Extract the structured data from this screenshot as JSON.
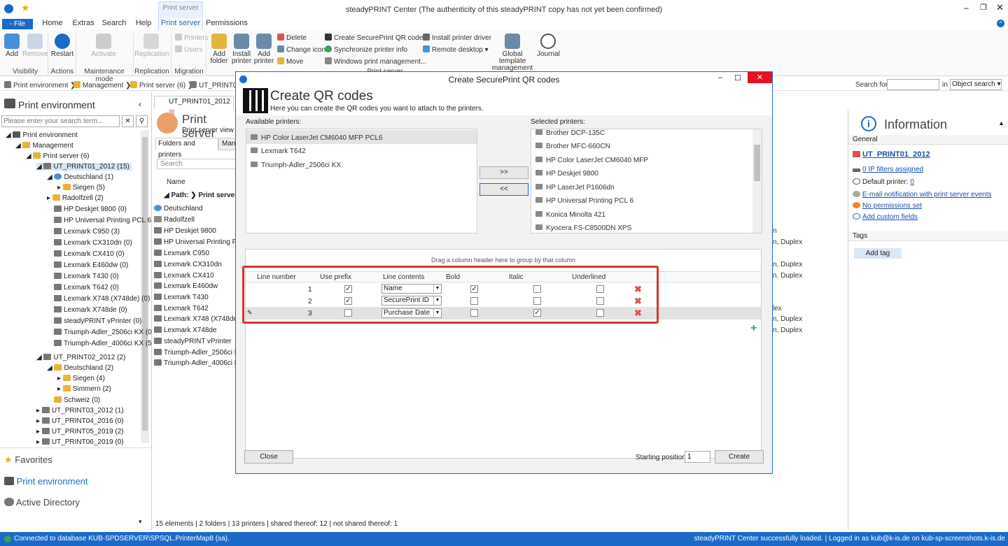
{
  "window": {
    "title": "steadyPRINT Center (The authenticity of this steadyPRINT copy has not yet been confirmed)",
    "context_tab": "Print server"
  },
  "tabs": [
    "- File",
    "Home",
    "Extras",
    "Search",
    "Help",
    "Print server",
    "Permissions"
  ],
  "ribbon": {
    "add": "Add",
    "remove": "Remove",
    "restart": "Restart",
    "activate": "Activate",
    "replication": "Replication",
    "printers": "Printers",
    "users": "Users",
    "add_folder": "Add folder",
    "install_printer": "Install printer",
    "add_printer": "Add printer",
    "delete": "Delete",
    "change_icon": "Change icon",
    "move": "Move",
    "create_qr": "Create SecurePrint QR codes",
    "sync_info": "Synchronize printer info",
    "windows_mgmt": "Windows print management...",
    "install_driver": "Install printer driver",
    "remote_desktop": "Remote desktop",
    "global_template": "Global template management",
    "journal": "Journal",
    "groups": {
      "visibility": "Visibility",
      "actions": "Actions",
      "maintenance": "Maintenance mode",
      "replication": "Replication",
      "migration": "Migration",
      "print_server": "Print server"
    }
  },
  "breadcrumb": {
    "items": [
      "Print environment",
      "Management",
      "Print server (6)",
      "UT_PRINT01_"
    ],
    "search_for": "Search for",
    "in": "in",
    "object_search": "Object search"
  },
  "left": {
    "header": "Print environment",
    "search_placeholder": "Please enter your search term...",
    "tree": [
      "Print environment",
      "Management",
      "Print server (6)",
      "UT_PRINT01_2012 (15)",
      "Deutschland (1)",
      "Siegen (5)",
      "Radolfzell (2)",
      "HP Deskjet 9800 (0)",
      "HP Universal Printing PCL 6",
      "Lexmark C950 (3)",
      "Lexmark CX310dn (0)",
      "Lexmark CX410 (0)",
      "Lexmark E460dw (0)",
      "Lexmark T430 (0)",
      "Lexmark T642 (0)",
      "Lexmark X748 (X748de) (0)",
      "Lexmark X748de (0)",
      "steadyPRINT vPrinter (0)",
      "Triumph-Adler_2506ci KX (0",
      "Triumph-Adler_4006ci KX (5",
      "UT_PRINT02_2012 (2)",
      "Deutschland (2)",
      "Siegen (4)",
      "Simmern (2)",
      "Schweiz (0)",
      "UT_PRINT03_2012 (1)",
      "UT_PRINT04_2016 (0)",
      "UT_PRINT05_2019 (2)",
      "UT_PRINT06_2019 (0)"
    ],
    "nav": [
      "Favorites",
      "Print environment",
      "Active Directory"
    ]
  },
  "middle": {
    "doc_tab": "UT_PRINT01_2012",
    "heading": "Print server",
    "subheading": "Print server view",
    "subtab1": "Folders and printers",
    "subtab2": "Man",
    "search": "Search",
    "col_name": "Name",
    "path": "Path:",
    "path_val": "Print server",
    "rows": [
      "Deutschland",
      "Radolfzell",
      "HP Deskjet 9800",
      "HP Universal Printing PC",
      "Lexmark C950",
      "Lexmark CX310dn",
      "Lexmark CX410",
      "Lexmark E460dw",
      "Lexmark T430",
      "Lexmark T642",
      "Lexmark X748 (X748de)",
      "Lexmark X748de",
      "steadyPRINT vPrinter",
      "Triumph-Adler_2506ci K",
      "Triumph-Adler_4006ci K"
    ],
    "status": "15 elements | 2 folders | 13 printers | shared thereof: 12 | not shared thereof: 1",
    "bleed": [
      "n",
      "n, Duplex",
      "n, Duplex",
      "n, Duplex",
      "lex",
      "n, Duplex",
      "n, Duplex"
    ]
  },
  "info": {
    "title": "Information",
    "general": "General",
    "server": "UT_PRINT01_2012",
    "ip": "0 IP filters assigned",
    "default_label": "Default printer:",
    "default_val": "0",
    "email": "E-mail notification with print server events",
    "perm": "No permissions set",
    "custom": "Add custom fields",
    "tags": "Tags",
    "add_tag": "Add tag"
  },
  "dialog": {
    "title": "Create SecurePrint QR codes",
    "heading": "Create QR codes",
    "sub": "Here you can create the QR codes you want to attach to the printers.",
    "available_label": "Available printers:",
    "selected_label": "Selected printers:",
    "available": [
      "HP Color LaserJet CM6040 MFP PCL6",
      "Lexmark T642",
      "Triumph-Adler_2506ci KX"
    ],
    "selected": [
      "Brother DCP-135C",
      "Brother MFC-660CN",
      "HP Color LaserJet CM6040 MFP",
      "HP Deskjet 9800",
      "HP LaserJet P1606dn",
      "HP Universal Printing PCL 6",
      "Konica Minolta 421",
      "Kyocera FS-C8500DN XPS"
    ],
    "move_right": ">>",
    "move_left": "<<",
    "group_hint": "Drag a column header here to group by that column",
    "columns": [
      "Line number",
      "Use prefix",
      "Line contents",
      "Bold",
      "Italic",
      "Underlined"
    ],
    "rows": [
      {
        "n": "1",
        "prefix": true,
        "content": "Name",
        "bold": true,
        "italic": false,
        "under": false
      },
      {
        "n": "2",
        "prefix": true,
        "content": "SecurePrint ID",
        "bold": false,
        "italic": false,
        "under": false
      },
      {
        "n": "3",
        "prefix": false,
        "content": "Purchase Date",
        "bold": false,
        "italic": true,
        "under": false
      }
    ],
    "close": "Close",
    "start_label": "Starting position",
    "start_val": "1",
    "create": "Create"
  },
  "statusbar": {
    "left": "Connected to database KUB-SPDSERVER\\SPSQL.PrinterMap8 (sa).",
    "right": "steadyPRINT Center successfully loaded. | Logged in as kub@k-is.de on kub-sp-screenshots.k-is.de"
  },
  "colors": {
    "accent": "#1b6ac9",
    "highlight": "#d9342b"
  }
}
